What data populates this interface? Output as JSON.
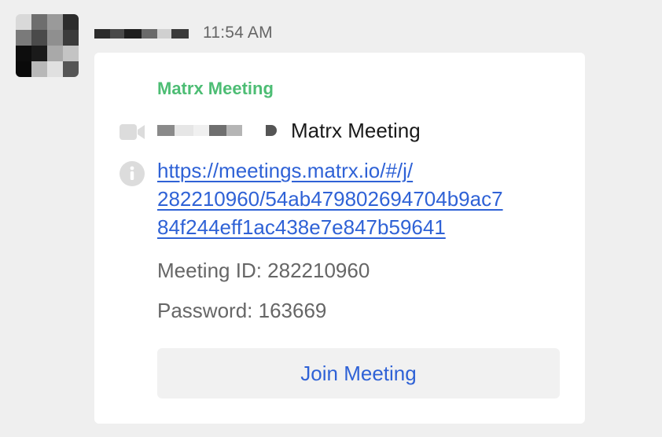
{
  "message": {
    "sender_name": "",
    "timestamp": "11:54 AM"
  },
  "card": {
    "title": "Matrx Meeting",
    "topic_suffix": "Matrx Meeting",
    "link_lines": [
      "https://meetings.matrx.io/#/j/",
      "282210960/54ab479802694704b9ac7",
      "84f244eff1ac438e7e847b59641"
    ],
    "meeting_id_text": "Meeting ID: 282210960",
    "password_text": "Password: 163669",
    "join_label": "Join Meeting",
    "icons": {
      "topic": "video-camera-icon",
      "link": "info-icon"
    }
  },
  "colors": {
    "background": "#efefef",
    "card_background": "#ffffff",
    "title_green": "#4dbd74",
    "link_blue": "#2f62d6",
    "muted_text": "#666666",
    "button_background": "#f1f1f1"
  }
}
